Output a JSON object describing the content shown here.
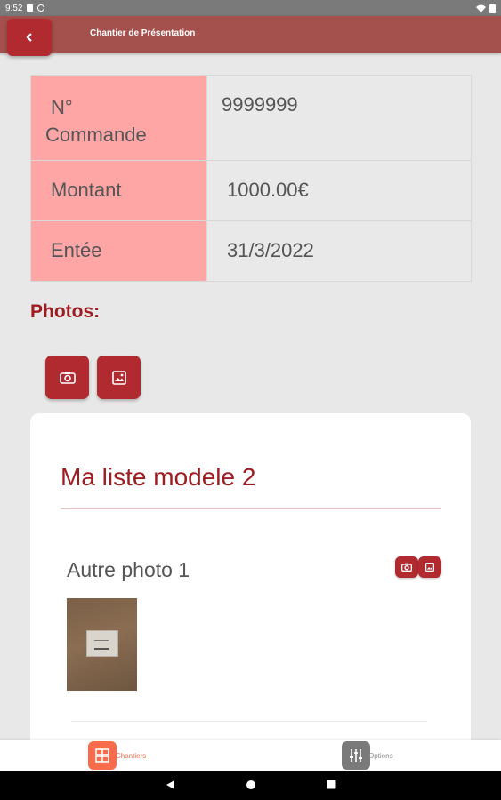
{
  "status_bar": {
    "time": "9:52"
  },
  "app_bar": {
    "title": "Chantier de Présentation",
    "back_label": "‹"
  },
  "order_table": {
    "rows": [
      {
        "label_line1": "N°",
        "label_line2": "Commande",
        "value": "9999999"
      },
      {
        "label": "Montant",
        "value": "1000.00€"
      },
      {
        "label": "Entée",
        "value": "31/3/2022"
      }
    ]
  },
  "photos": {
    "title": "Photos:"
  },
  "model_card": {
    "title": "Ma liste modele 2",
    "items": [
      {
        "label": "Autre photo 1"
      }
    ]
  },
  "bottom_nav": {
    "items": [
      {
        "label": "Chantiers",
        "icon": "grid-icon",
        "color": "#f96c4b",
        "active": true
      },
      {
        "label": "Options",
        "icon": "sliders-icon",
        "color": "#7a7a7a",
        "active": false
      }
    ]
  },
  "colors": {
    "primary": "#b12a30",
    "app_bar": "#a4504c",
    "label_cell": "#fea5a5",
    "title_red": "#9e1d22"
  }
}
